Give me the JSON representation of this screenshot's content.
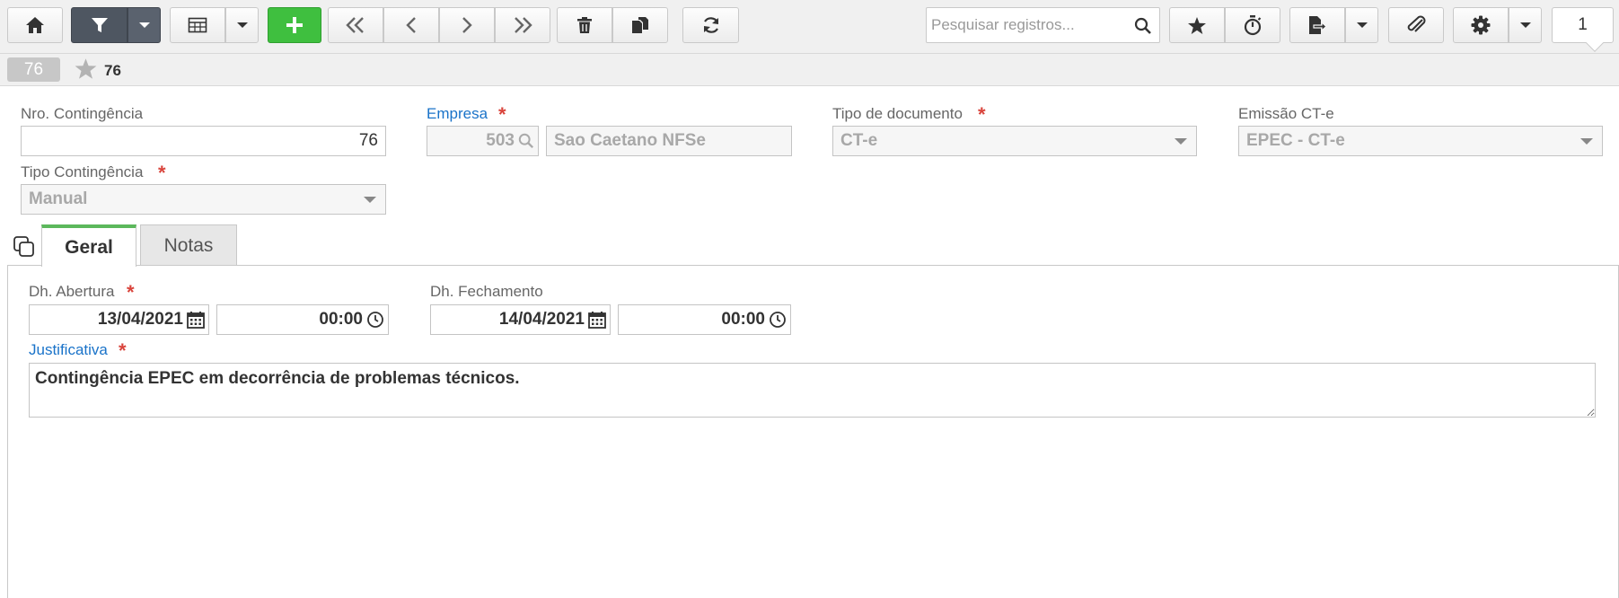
{
  "toolbar": {
    "buttons": [
      {
        "name": "home-button",
        "icon": "home-icon"
      },
      {
        "name": "filter-button",
        "icon": "filter-icon"
      },
      {
        "name": "grid-view-button",
        "icon": "table-icon"
      },
      {
        "name": "new-record-button",
        "icon": "plus-icon"
      },
      {
        "name": "first-record-button",
        "icon": "double-chevron-left-icon"
      },
      {
        "name": "previous-record-button",
        "icon": "chevron-left-icon"
      },
      {
        "name": "next-record-button",
        "icon": "chevron-right-icon"
      },
      {
        "name": "last-record-button",
        "icon": "double-chevron-right-icon"
      },
      {
        "name": "delete-button",
        "icon": "trash-icon"
      },
      {
        "name": "duplicate-button",
        "icon": "copy-icon"
      },
      {
        "name": "refresh-button",
        "icon": "refresh-icon"
      },
      {
        "name": "favorite-button",
        "icon": "star-icon"
      },
      {
        "name": "timer-button",
        "icon": "stopwatch-icon"
      },
      {
        "name": "export-button",
        "icon": "export-file-icon"
      },
      {
        "name": "attachment-button",
        "icon": "paperclip-icon"
      },
      {
        "name": "settings-button",
        "icon": "gear-icon"
      }
    ],
    "search_placeholder": "Pesquisar registros...",
    "page_number": "1"
  },
  "record": {
    "badge": "76",
    "label": "76"
  },
  "form": {
    "nro_contingencia": {
      "label": "Nro. Contingência",
      "value": "76"
    },
    "empresa": {
      "label": "Empresa",
      "required_mark": "*",
      "code": "503",
      "name": "Sao Caetano NFSe"
    },
    "tipo_documento": {
      "label": "Tipo de documento",
      "required_mark": "*",
      "value": "CT-e"
    },
    "emissao_cte": {
      "label": "Emissão CT-e",
      "value": "EPEC - CT-e"
    },
    "tipo_contingencia": {
      "label": "Tipo Contingência",
      "required_mark": "*",
      "value": "Manual"
    }
  },
  "tabs": [
    {
      "label": "Geral",
      "active": true
    },
    {
      "label": "Notas",
      "active": false
    }
  ],
  "geral": {
    "dh_abertura": {
      "label": "Dh. Abertura",
      "required_mark": "*",
      "date": "13/04/2021",
      "time": "00:00"
    },
    "dh_fechamento": {
      "label": "Dh. Fechamento",
      "date": "14/04/2021",
      "time": "00:00"
    },
    "justificativa": {
      "label": "Justificativa",
      "required_mark": "*",
      "value": "Contingência EPEC em decorrência de problemas técnicos."
    }
  },
  "colors": {
    "accent_blue": "#1a73c9",
    "required_red": "#d9443c",
    "new_button_green": "#3fbf3f",
    "active_tab_green": "#5cb85c",
    "filter_button_dark": "#4e5661"
  }
}
